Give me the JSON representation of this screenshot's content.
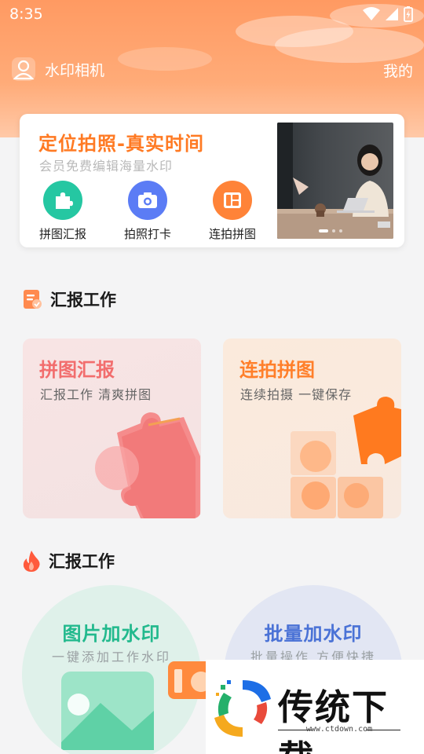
{
  "status_bar": {
    "time": "8:35"
  },
  "app_bar": {
    "title": "水印相机",
    "mine_label": "我的"
  },
  "banner": {
    "title": "定位拍照-真实时间",
    "subtitle": "会员免费编辑海量水印",
    "quick_actions": [
      {
        "label": "拼图汇报",
        "icon": "puzzle-icon",
        "color": "#25c7a2"
      },
      {
        "label": "拍照打卡",
        "icon": "camera-icon",
        "color": "#5b7cf5"
      },
      {
        "label": "连拍拼图",
        "icon": "grid-icon",
        "color": "#ff8338"
      }
    ]
  },
  "section1": {
    "title": "汇报工作",
    "cards": [
      {
        "title": "拼图汇报",
        "subtitle": "汇报工作 清爽拼图",
        "accent": "#f26d6d"
      },
      {
        "title": "连拍拼图",
        "subtitle": "连续拍摄  一键保存",
        "accent": "#ff7f2a"
      }
    ]
  },
  "section2": {
    "title": "汇报工作",
    "cards": [
      {
        "title": "图片加水印",
        "subtitle": "一键添加工作水印",
        "accent": "#22b98d"
      },
      {
        "title": "批量加水印",
        "subtitle": "批量操作 方便快捷",
        "accent": "#4a72d6"
      }
    ]
  },
  "watermark": {
    "brand": "传统下载",
    "url": "www.ctdown.com"
  }
}
